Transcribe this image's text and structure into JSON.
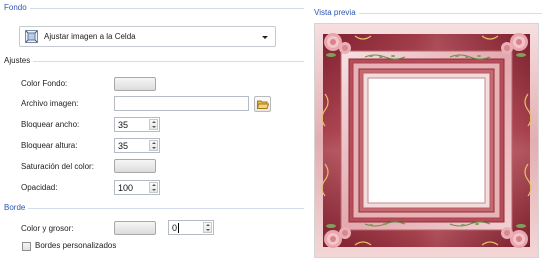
{
  "fondo": {
    "title": "Fondo",
    "mode_selected": "Ajustar imagen a la Celda",
    "mode_icon": "image-fit-icon"
  },
  "ajustes": {
    "title": "Ajustes",
    "color_fondo_label": "Color Fondo:",
    "archivo_imagen_label": "Archivo imagen:",
    "archivo_imagen_value": "",
    "folder_icon": "folder-open-icon",
    "bloquear_ancho_label": "Bloquear ancho:",
    "bloquear_ancho_value": "35",
    "bloquear_altura_label": "Bloquear altura:",
    "bloquear_altura_value": "35",
    "saturacion_label": "Saturación del color:",
    "opacidad_label": "Opacidad:",
    "opacidad_value": "100"
  },
  "borde": {
    "title": "Borde",
    "color_grosor_label": "Color y grosor:",
    "grosor_value": "0",
    "bordes_personalizados_label": "Bordes personalizados",
    "bordes_personalizados_checked": false
  },
  "vista_previa": {
    "title": "Vista previa",
    "image": "decorative-rose-frame-image"
  },
  "colors": {
    "section_title": "#2d55b0",
    "frame_red": "#a83a44",
    "frame_light": "#f3d2d2"
  }
}
